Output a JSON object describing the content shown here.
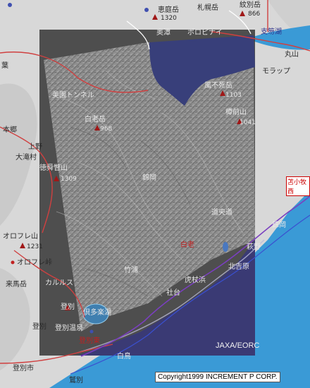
{
  "map": {
    "labels": {
      "eniwa_dake": "恵庭岳",
      "eniwa_dake_elev": "1320",
      "sapporo_area": "札幌岳",
      "monbetsu_dake": "紋別岳",
      "monbetsu_elev": "866",
      "shikotsu_ko": "支笏湖",
      "okotan": "奥潭",
      "poropinai": "ポロピナイ",
      "marukoma": "丸山",
      "morappu": "モラップ",
      "kasa": "葉",
      "bizen_tunnel": "美園トンネル",
      "fuppushi_dake": "風不死岳",
      "fuppushi_elev": "1103",
      "tarumae_san": "樽前山",
      "tarumae_elev": "1041",
      "hon_go": "本郷",
      "shirataki": "白老岳",
      "shirataki_elev": "968",
      "kamino": "上野",
      "otaki": "大滝村",
      "tokushun_betsu": "徳舜瞥山",
      "tokushun_elev": "1309",
      "ippon_matsu": "錦岡",
      "tomakomai_nishi": "苫小牧西",
      "nishiki_oka": "錦岡",
      "michi": "道央道",
      "shiraoi": "白老",
      "hagino": "萩野",
      "kita_yoshihara": "北吉原",
      "orofure_yama": "オロフレ山",
      "orofure_elev": "1231",
      "orofure_toge": "オロフレ峠",
      "raiba_dake": "来馬岳",
      "karurusu": "カルルス",
      "kuttara_ko": "倶多楽湖",
      "noboribetsu_onsen": "登別温泉",
      "noboribetsu": "登別",
      "noboribetsu_higashi": "登別東",
      "noboribetsu_shi": "登別市",
      "washibetsu": "鷲別",
      "hakuchou": "白鳥",
      "takeura": "竹浦",
      "kojohama": "虎杖浜",
      "shadai": "社台"
    },
    "credit": "JAXA/EORC",
    "copyright": "Copyright1999 INCREMENT P CORP."
  }
}
